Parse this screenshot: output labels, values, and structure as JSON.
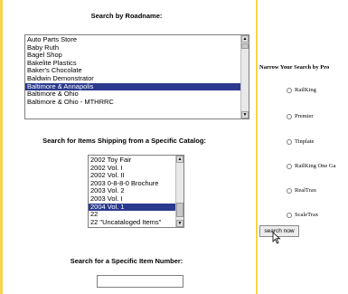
{
  "roadname": {
    "heading": "Search by Roadname:",
    "items": [
      "Auto Parts Store",
      "Baby Ruth",
      "Bagel Shop",
      "Bakelite Plastics",
      "Baker's Chocolate",
      "Baldwin Demonstrator",
      "Baltimore & Annapolis",
      "Baltimore & Ohio",
      "Baltimore & Ohio - MTHRRC"
    ],
    "selected": "Baltimore & Annapolis"
  },
  "catalog": {
    "heading": "Search for Items Shipping from a Specific Catalog:",
    "items": [
      "2002 Toy Fair",
      "2002 Vol. I",
      "2002 Vol. II",
      "2003 0-8-8-0 Brochure",
      "2003 Vol. 2",
      "2003 Vol. I",
      "2004 Vol. 1",
      "22",
      "22 \"Uncataloged Items\""
    ],
    "selected": "2004 Vol. 1"
  },
  "item_number": {
    "heading": "Search for a Specific Item Number:",
    "value": ""
  },
  "narrow": {
    "title": "Narrow Your Search by Pro",
    "options": [
      "RailKing",
      "Premier",
      "Tinplate",
      "RailKing One Ga",
      "RealTrax",
      "ScaleTrax"
    ]
  },
  "search_button": "search now",
  "colors": {
    "accent_rule": "#f5d34a",
    "selection": "#2b3a8f"
  }
}
